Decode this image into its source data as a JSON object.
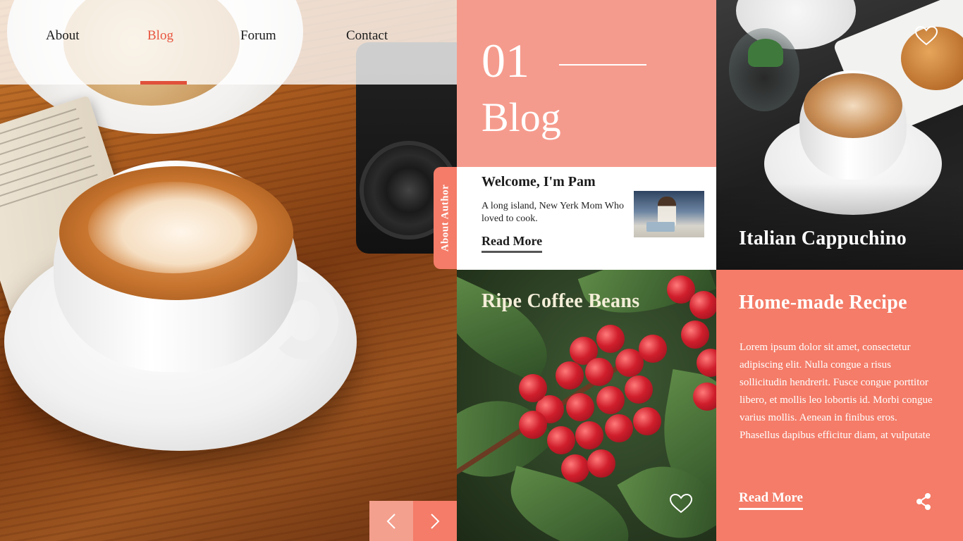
{
  "nav": {
    "items": [
      {
        "label": "About"
      },
      {
        "label": "Blog"
      },
      {
        "label": "Forum"
      },
      {
        "label": "Contact"
      }
    ],
    "active_index": 1
  },
  "blog_header": {
    "number": "01",
    "title": "Blog"
  },
  "author": {
    "tab_label": "About Author",
    "title": "Welcome, I'm Pam",
    "description": "A long island, New Yerk Mom Who loved to cook.",
    "read_more": "Read More"
  },
  "cards": {
    "cappuchino": {
      "title": "Italian Cappuchino",
      "icon": "heart-outline-icon"
    },
    "beans": {
      "title": "Ripe Coffee Beans",
      "icon": "heart-outline-icon"
    },
    "recipe": {
      "title": "Home-made Recipe",
      "body": "Lorem ipsum dolor sit amet, consectetur adipiscing elit. Nulla congue a risus sollicitudin hendrerit. Fusce congue porttitor libero, et mollis leo lobortis id. Morbi congue varius mollis. Aenean in finibus eros. Phasellus dapibus efficitur diam, at vulputate",
      "read_more": "Read More",
      "icon": "share-icon"
    }
  },
  "slider": {
    "prev_icon": "chevron-left-icon",
    "next_icon": "chevron-right-icon"
  },
  "colors": {
    "accent": "#e0503a",
    "salmon": "#f47c68",
    "light_salmon": "#f59b8d"
  }
}
